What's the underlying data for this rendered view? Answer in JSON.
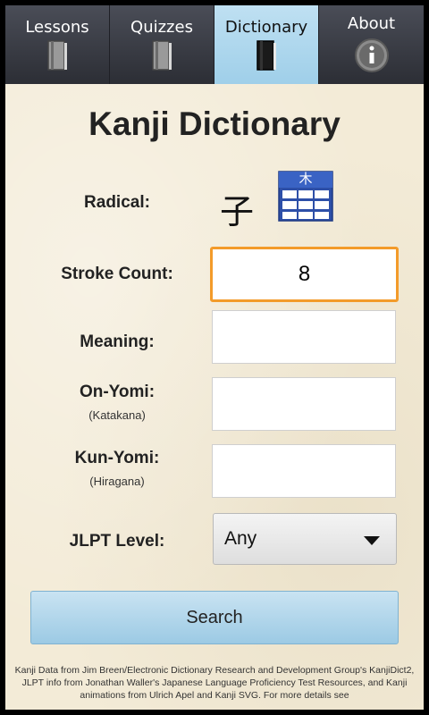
{
  "tabs": [
    {
      "label": "Lessons",
      "icon": "book-icon"
    },
    {
      "label": "Quizzes",
      "icon": "book-icon"
    },
    {
      "label": "Dictionary",
      "icon": "book-icon"
    },
    {
      "label": "About",
      "icon": "info-icon"
    }
  ],
  "active_tab": "Dictionary",
  "title": "Kanji Dictionary",
  "form": {
    "radical_label": "Radical:",
    "radical_value": "子",
    "radical_picker_glyph": "木",
    "stroke_count_label": "Stroke Count:",
    "stroke_count_value": "8",
    "meaning_label": "Meaning:",
    "meaning_value": "",
    "onyomi_label": "On-Yomi:",
    "onyomi_sub": "(Katakana)",
    "onyomi_value": "",
    "kunyomi_label": "Kun-Yomi:",
    "kunyomi_sub": "(Hiragana)",
    "kunyomi_value": "",
    "jlpt_label": "JLPT Level:",
    "jlpt_value": "Any"
  },
  "search_label": "Search",
  "footer_text": "Kanji Data from Jim Breen/Electronic Dictionary Research and Development Group's KanjiDict2, JLPT info from Jonathan Waller's Japanese Language Proficiency Test Resources, and Kanji animations from Ulrich Apel and Kanji SVG. For more details see",
  "colors": {
    "active_tab": "#9fcfe9",
    "focus_border": "#f39b2a",
    "search_button": "#9ccae4",
    "radical_button": "#2d4fa8"
  }
}
